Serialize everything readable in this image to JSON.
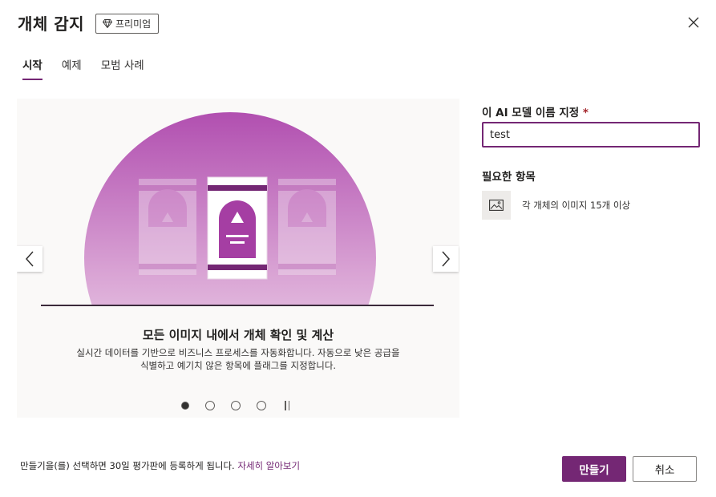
{
  "dialog": {
    "title": "개체 감지",
    "premium_badge": "프리미엄",
    "close_icon": "close-icon"
  },
  "tabs": [
    {
      "label": "시작",
      "active": true
    },
    {
      "label": "예제",
      "active": false
    },
    {
      "label": "모범 사례",
      "active": false
    }
  ],
  "carousel": {
    "slide_heading": "모든 이미지 내에서 개체 확인 및 계산",
    "slide_description": "실시간 데이터를 기반으로 비즈니스 프로세스를 자동화합니다. 자동으로 낮은 공급을 식별하고 예기치 않은 항목에 플래그를 지정합니다.",
    "slide_count": 4,
    "active_slide": 1,
    "prev_icon": "chevron-left-icon",
    "next_icon": "chevron-right-icon",
    "pause_icon": "pause-icon"
  },
  "form": {
    "name_label": "이 AI 모델 이름 지정",
    "required_marker": "*",
    "name_value": "test",
    "requirements_heading": "필요한 항목",
    "requirement_item": "각 개체의 이미지 15개 이상",
    "requirement_icon": "image-icon"
  },
  "footer": {
    "note": "만들기을(를) 선택하면 30일 평가판에 등록하게 됩니다.",
    "learn_more": "자세히 알아보기",
    "create_label": "만들기",
    "cancel_label": "취소"
  },
  "colors": {
    "accent": "#742774",
    "required": "#a4262c",
    "panel": "#faf9f8"
  }
}
